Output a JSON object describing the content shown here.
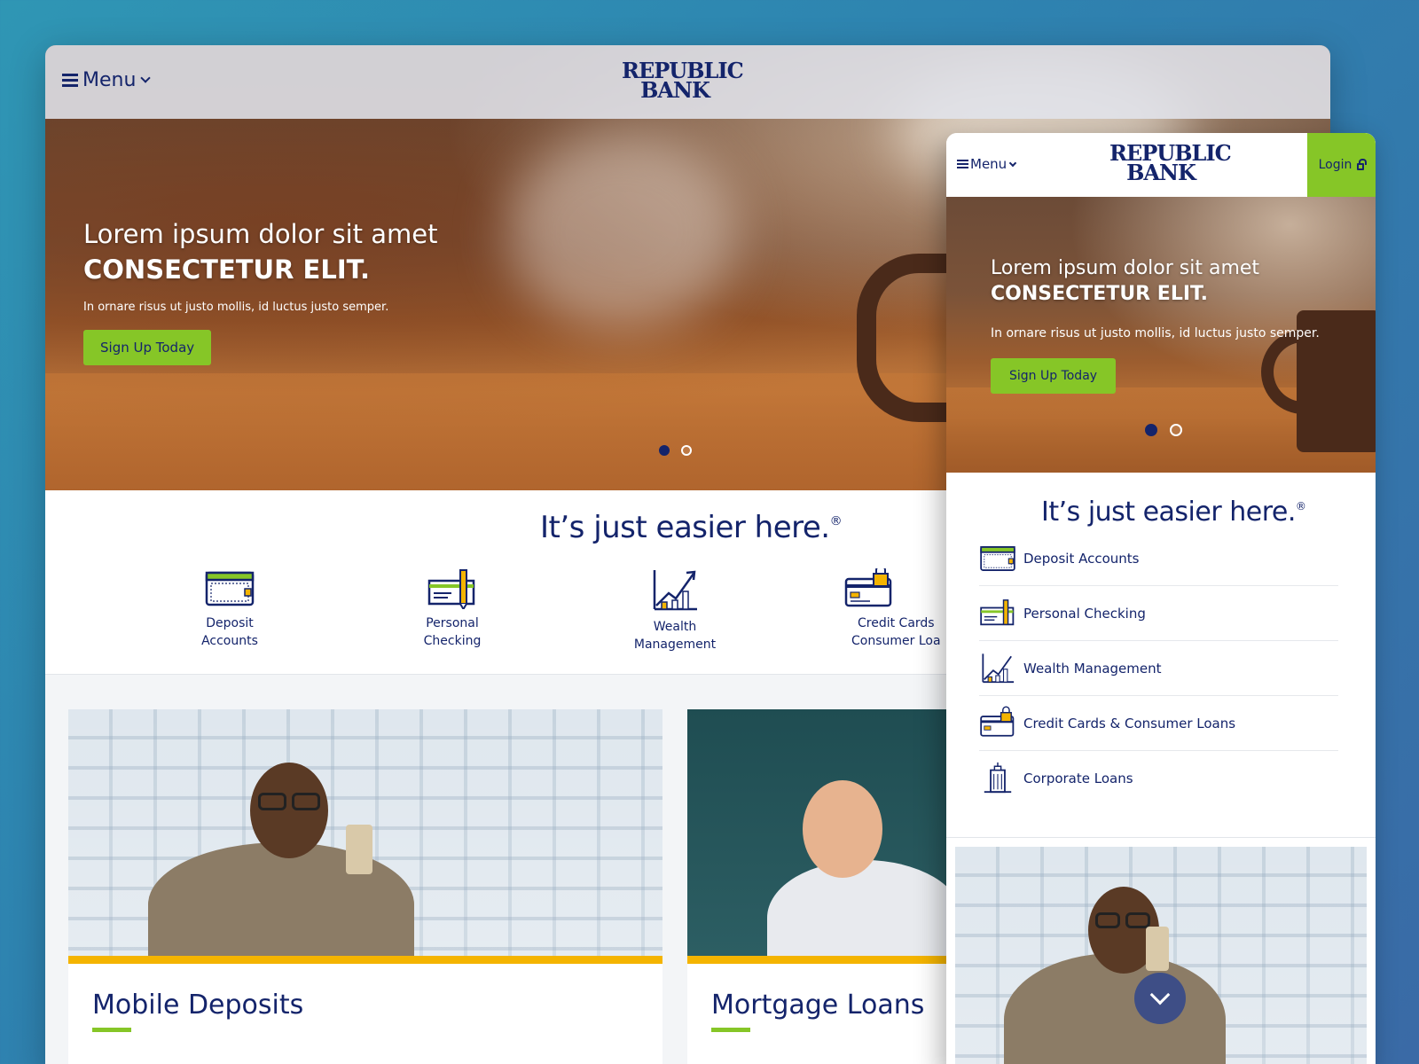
{
  "brand": {
    "logo_line1": "REPUBLIC",
    "logo_line2": "BANK",
    "navy": "#14246b",
    "green": "#86c627",
    "yellow": "#f4b400"
  },
  "header": {
    "menu_label": "Menu",
    "login_label": "Login"
  },
  "hero": {
    "line1": "Lorem ipsum dolor sit amet",
    "line2": "CONSECTETUR ELIT.",
    "subtitle": "In ornare risus ut justo mollis, id luctus justo semper.",
    "cta_label": "Sign Up Today",
    "carousel": {
      "slides": 2,
      "active": 1
    }
  },
  "features": {
    "tagline": "It’s just easier here.",
    "tagline_mark": "®",
    "desktop_items": [
      {
        "line1": "Deposit",
        "line2": "Accounts",
        "icon": "wallet-icon"
      },
      {
        "line1": "Personal",
        "line2": "Checking",
        "icon": "check-pen-icon"
      },
      {
        "line1": "Wealth",
        "line2": "Management",
        "icon": "growth-chart-icon"
      },
      {
        "line1": "Credit Cards",
        "line2": "Consumer Loa",
        "icon": "credit-card-lock-icon"
      }
    ],
    "mobile_items": [
      {
        "label": "Deposit Accounts",
        "icon": "wallet-icon"
      },
      {
        "label": "Personal Checking",
        "icon": "check-pen-icon"
      },
      {
        "label": "Wealth Management",
        "icon": "growth-chart-icon"
      },
      {
        "label": "Credit Cards & Consumer Loans",
        "icon": "credit-card-lock-icon"
      },
      {
        "label": "Corporate Loans",
        "icon": "building-icon"
      }
    ]
  },
  "cards": [
    {
      "title": "Mobile Deposits"
    },
    {
      "title": "Mortgage Loans"
    }
  ]
}
